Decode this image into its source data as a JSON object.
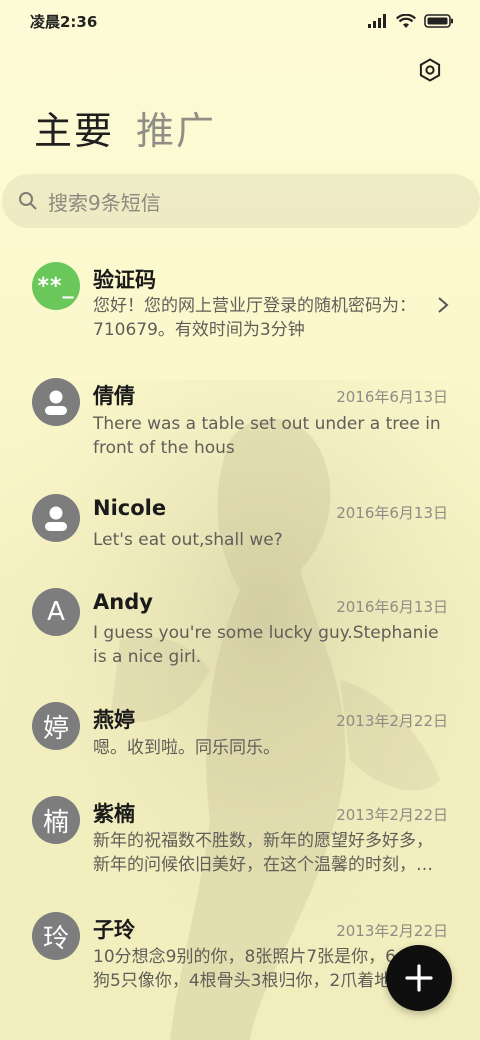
{
  "status_bar": {
    "time": "凌晨2:36",
    "icons": [
      "signal-icon",
      "wifi-icon",
      "battery-icon"
    ]
  },
  "header": {
    "settings_icon": "gear-icon",
    "tabs": [
      {
        "label": "主要",
        "active": true
      },
      {
        "label": "推广",
        "active": false
      }
    ]
  },
  "search": {
    "icon": "search-icon",
    "placeholder": "搜索9条短信"
  },
  "messages": [
    {
      "avatar_text": "**_",
      "name": "验证码",
      "date": "",
      "preview_lines": [
        "您好！您的网上营业厅登录的随机密码为：",
        "710679。有效时间为3分钟"
      ],
      "has_chevron": true
    },
    {
      "avatar_text": "",
      "name": "倩倩",
      "date": "2016年6月13日",
      "preview_lines": [
        "There was a table set out under a tree in",
        "front of the hous"
      ]
    },
    {
      "avatar_text": "",
      "name": "Nicole",
      "date": "2016年6月13日",
      "preview_lines": [
        "Let's eat out,shall we?"
      ]
    },
    {
      "avatar_text": "A",
      "name": "Andy",
      "date": "2016年6月13日",
      "preview_lines": [
        "I guess you're some lucky guy.Stephanie",
        "is a nice girl."
      ]
    },
    {
      "avatar_text": "婷",
      "name": "燕婷",
      "date": "2013年2月22日",
      "preview_lines": [
        "嗯。收到啦。同乐同乐。"
      ]
    },
    {
      "avatar_text": "楠",
      "name": "紫楠",
      "date": "2013年2月22日",
      "preview_lines": [
        "新年的祝福数不胜数，新年的愿望好多好多，",
        "新年的问候依旧美好，在这个温馨的时刻，…"
      ]
    },
    {
      "avatar_text": "玲",
      "name": "子玲",
      "date": "2013年2月22日",
      "preview_lines": [
        "10分想念9别的你，8张照片7张是你，6",
        "狗5只像你，4根骨头3根归你，2爪着地"
      ]
    }
  ],
  "fab": {
    "icon": "plus-icon"
  },
  "colors": {
    "accent_green": "#6ac85b",
    "avatar_gray": "#7d7d7d",
    "fab": "#0f0f0f"
  }
}
